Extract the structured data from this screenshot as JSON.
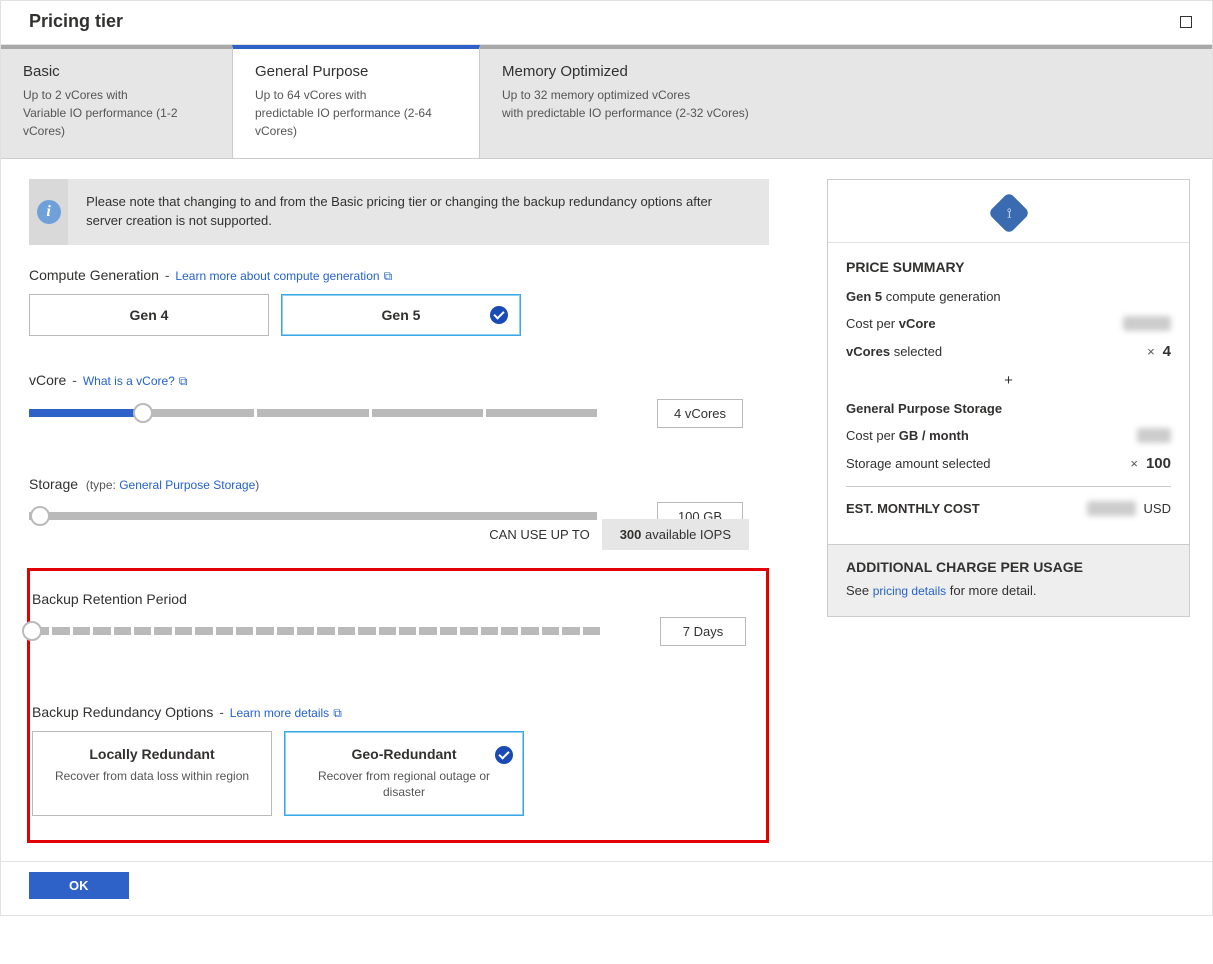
{
  "header": {
    "title": "Pricing tier"
  },
  "tiers": [
    {
      "title": "Basic",
      "sub1": "Up to 2 vCores with",
      "sub2": "Variable IO performance (1-2 vCores)"
    },
    {
      "title": "General Purpose",
      "sub1": "Up to 64 vCores with",
      "sub2": "predictable IO performance (2-64 vCores)"
    },
    {
      "title": "Memory Optimized",
      "sub1": "Up to 32 memory optimized vCores",
      "sub2": "with predictable IO performance (2-32 vCores)"
    }
  ],
  "notice": "Please note that changing to and from the Basic pricing tier or changing the backup redundancy options after server creation is not supported.",
  "compute": {
    "label": "Compute Generation",
    "link": "Learn more about compute generation",
    "options": [
      {
        "name": "Gen 4",
        "selected": false
      },
      {
        "name": "Gen 5",
        "selected": true
      }
    ]
  },
  "vcore": {
    "label": "vCore",
    "link": "What is a vCore?",
    "value_display": "4 vCores"
  },
  "storage": {
    "label": "Storage",
    "type_prefix": "(type:",
    "type_link": "General Purpose Storage",
    "type_suffix": ")",
    "value_display": "100 GB",
    "iops_label": "CAN USE UP TO",
    "iops_value_bold": "300",
    "iops_value_rest": " available IOPS"
  },
  "backup": {
    "label": "Backup Retention Period",
    "value_display": "7 Days"
  },
  "redundancy": {
    "label": "Backup Redundancy Options",
    "link": "Learn more details",
    "options": [
      {
        "title": "Locally Redundant",
        "sub": "Recover from data loss within region",
        "selected": false
      },
      {
        "title": "Geo-Redundant",
        "sub": "Recover from regional outage or disaster",
        "selected": true
      }
    ]
  },
  "summary": {
    "title": "PRICE SUMMARY",
    "gen_bold": "Gen 5",
    "gen_rest": " compute generation",
    "cost_vcore_label_pre": "Cost per ",
    "cost_vcore_label_bold": "vCore",
    "vcores_sel_bold": "vCores",
    "vcores_sel_rest": " selected",
    "vcores_sel_mult": "×",
    "vcores_sel_val": "4",
    "gp_title": "General Purpose Storage",
    "cost_gb_pre": "Cost per ",
    "cost_gb_bold": "GB / month",
    "storage_sel": "Storage amount selected",
    "storage_sel_mult": "×",
    "storage_sel_val": "100",
    "est_label": "EST. MONTHLY COST",
    "est_currency": " USD",
    "additional_title": "ADDITIONAL CHARGE PER USAGE",
    "additional_pre": "See ",
    "additional_link": "pricing details",
    "additional_post": " for more detail."
  },
  "footer": {
    "ok": "OK"
  }
}
